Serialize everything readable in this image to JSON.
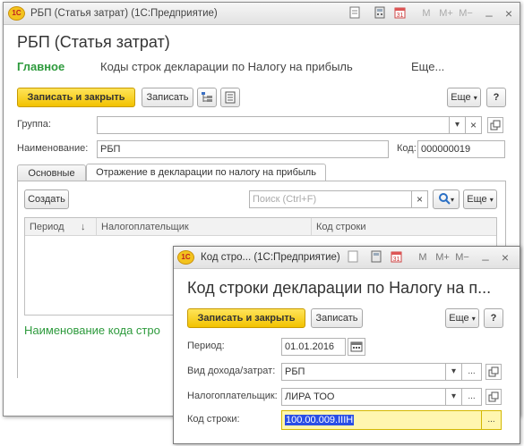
{
  "main_window": {
    "title": "РБП (Статья затрат)  (1С:Предприятие)",
    "tb_icons": [
      "document-icon",
      "calculator-icon",
      "calendar-icon",
      "m-icon",
      "m-plus-icon",
      "m-minus-icon",
      "minimize-icon",
      "close-icon"
    ],
    "tb_glyphs": {
      "m": "M",
      "m_plus": "M+",
      "m_minus": "M−",
      "minimize": "_",
      "close": "×"
    },
    "heading": "РБП (Статья затрат)",
    "nav": {
      "main": "Главное",
      "codes": "Коды строк декларации по Налогу на прибыль",
      "more": "Еще..."
    },
    "toolbar": {
      "save_close": "Записать и закрыть",
      "save": "Записать",
      "more": "Еще",
      "help": "?"
    },
    "form": {
      "group_label": "Группа:",
      "group_value": "",
      "name_label": "Наименование:",
      "name_value": "РБП",
      "code_label": "Код:",
      "code_value": "000000019"
    },
    "tabs": {
      "basic": "Основные",
      "reflection": "Отражение в декларации по налогу на прибыль"
    },
    "list_toolbar": {
      "create": "Создать",
      "search_placeholder": "Поиск (Ctrl+F)",
      "more": "Еще"
    },
    "table": {
      "columns": [
        "Период",
        "Налогоплательщик",
        "Код строки"
      ],
      "sort_arrow": "↓"
    },
    "footer_label": "Наименование кода стро"
  },
  "dialog": {
    "title": "Код стро... (1С:Предприятие)",
    "heading": "Код строки декларации по Налогу на п...",
    "toolbar": {
      "save_close": "Записать и закрыть",
      "save": "Записать",
      "more": "Еще",
      "help": "?"
    },
    "fields": {
      "period_label": "Период:",
      "period_value": "01.01.2016",
      "income_label": "Вид дохода/затрат:",
      "income_value": "РБП",
      "taxpayer_label": "Налогоплательщик:",
      "taxpayer_value": "ЛИРА ТОО",
      "code_label": "Код строки:",
      "code_value": "100.00.009.IIIН"
    }
  },
  "colors": {
    "accent_yellow": "#f2c200",
    "nav_green": "#2d9a3c",
    "selection_blue": "#2a4ee6",
    "focus_yellow": "#fff6b0"
  }
}
